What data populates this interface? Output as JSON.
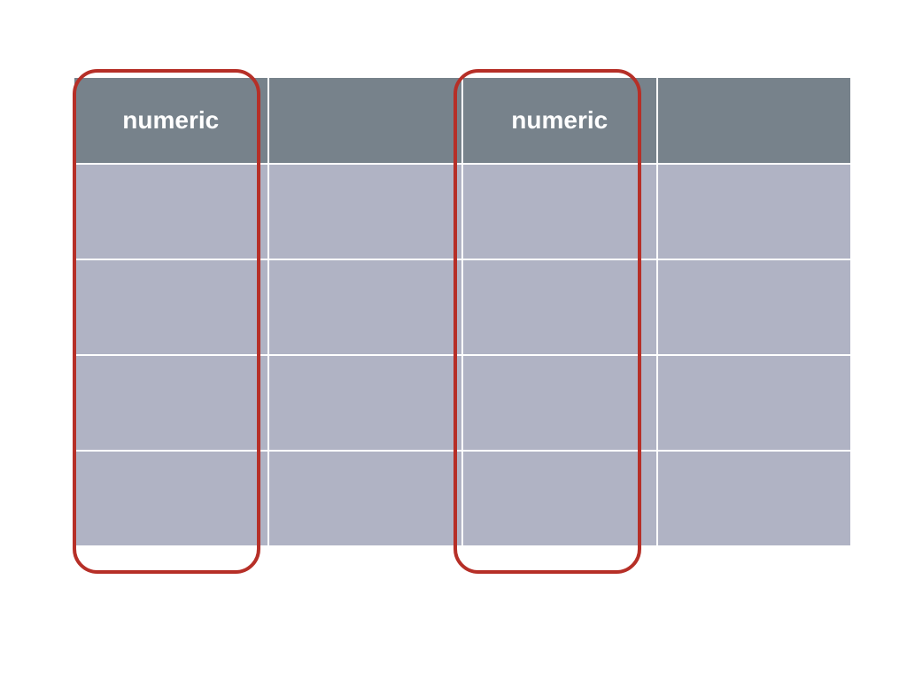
{
  "columns": [
    {
      "header": "numeric",
      "highlighted": true
    },
    {
      "header": "",
      "highlighted": false
    },
    {
      "header": "numeric",
      "highlighted": true
    },
    {
      "header": "",
      "highlighted": false
    }
  ],
  "body_row_count": 4,
  "colors": {
    "header_bg": "#77828b",
    "body_bg": "#b0b3c4",
    "highlight_border": "#b62f27"
  }
}
